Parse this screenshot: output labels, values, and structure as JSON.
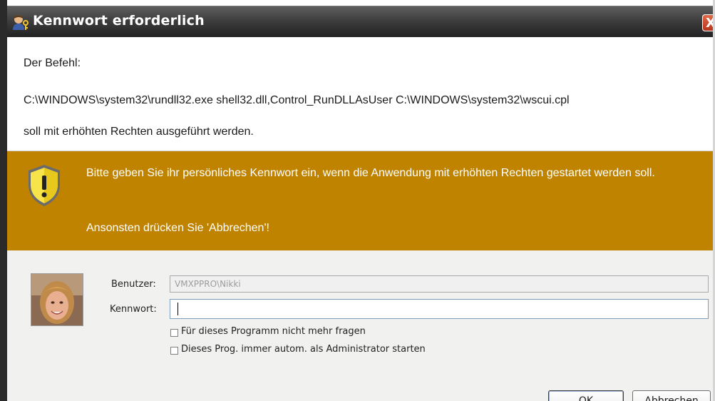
{
  "window": {
    "title": "Kennwort erforderlich",
    "close_glyph": "X"
  },
  "message": {
    "line1": "Der Befehl:",
    "command": "C:\\WINDOWS\\system32\\rundll32.exe shell32.dll,Control_RunDLLAsUser C:\\WINDOWS\\system32\\wscui.cpl",
    "line3": "soll mit erhöhten Rechten ausgeführt werden."
  },
  "warning": {
    "icon": "shield-warning-icon",
    "text": "Bitte geben Sie ihr persönliches Kennwort ein, wenn die Anwendung mit erhöhten Rechten gestartet werden soll.",
    "text2": "Ansonsten drücken Sie 'Abbrechen'!",
    "color": "#bf8300"
  },
  "form": {
    "user_label": "Benutzer:",
    "user_value": "VMXPPRO\\Nikki",
    "password_label": "Kennwort:",
    "password_value": "",
    "checkbox1_label": "Für dieses Programm nicht mehr fragen",
    "checkbox1_checked": false,
    "checkbox2_label": "Dieses Prog. immer autom. als Administrator starten",
    "checkbox2_checked": false
  },
  "buttons": {
    "ok": "OK",
    "cancel": "Abbrechen"
  }
}
